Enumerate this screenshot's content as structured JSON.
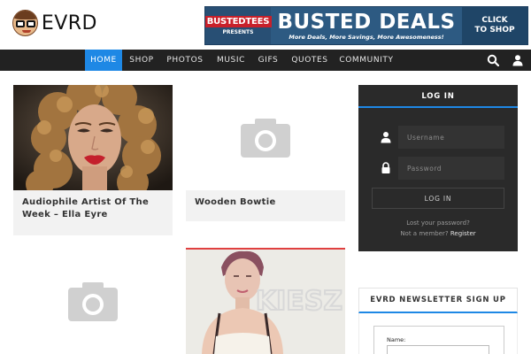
{
  "header": {
    "logo_text": "EVRD",
    "banner": {
      "brand": "BUSTEDTEES",
      "brand_sub": "PRESENTS",
      "title": "BUSTED DEALS",
      "tagline": "More Deals, More Savings, More Awesomeness!",
      "cta": "CLICK\nTO SHOP"
    }
  },
  "nav": {
    "items": [
      {
        "label": "HOME",
        "active": true
      },
      {
        "label": "SHOP",
        "active": false
      },
      {
        "label": "PHOTOS",
        "active": false
      },
      {
        "label": "MUSIC",
        "active": false
      },
      {
        "label": "GIFS",
        "active": false
      },
      {
        "label": "QUOTES",
        "active": false
      },
      {
        "label": "COMMUNITY",
        "active": false
      }
    ],
    "search_icon": "search-icon",
    "user_icon": "user-icon"
  },
  "posts": [
    {
      "title": "Audiophile Artist Of The Week – Ella Eyre"
    },
    {
      "title": "Wooden Bowtie"
    },
    {
      "title": ""
    },
    {
      "title": ""
    }
  ],
  "post_overlay_text": "KIESZ",
  "login": {
    "title": "LOG IN",
    "username_placeholder": "Username",
    "password_placeholder": "Password",
    "button": "LOG IN",
    "lost_password": "Lost your password?",
    "not_member": "Not a member?",
    "register": "Register"
  },
  "newsletter": {
    "title": "EVRD NEWSLETTER SIGN UP",
    "name_label": "Name:"
  },
  "colors": {
    "accent": "#1e88e5",
    "nav_bg": "#222222",
    "panel_bg": "#2a2a2a",
    "card_bg": "#f2f2f2"
  }
}
